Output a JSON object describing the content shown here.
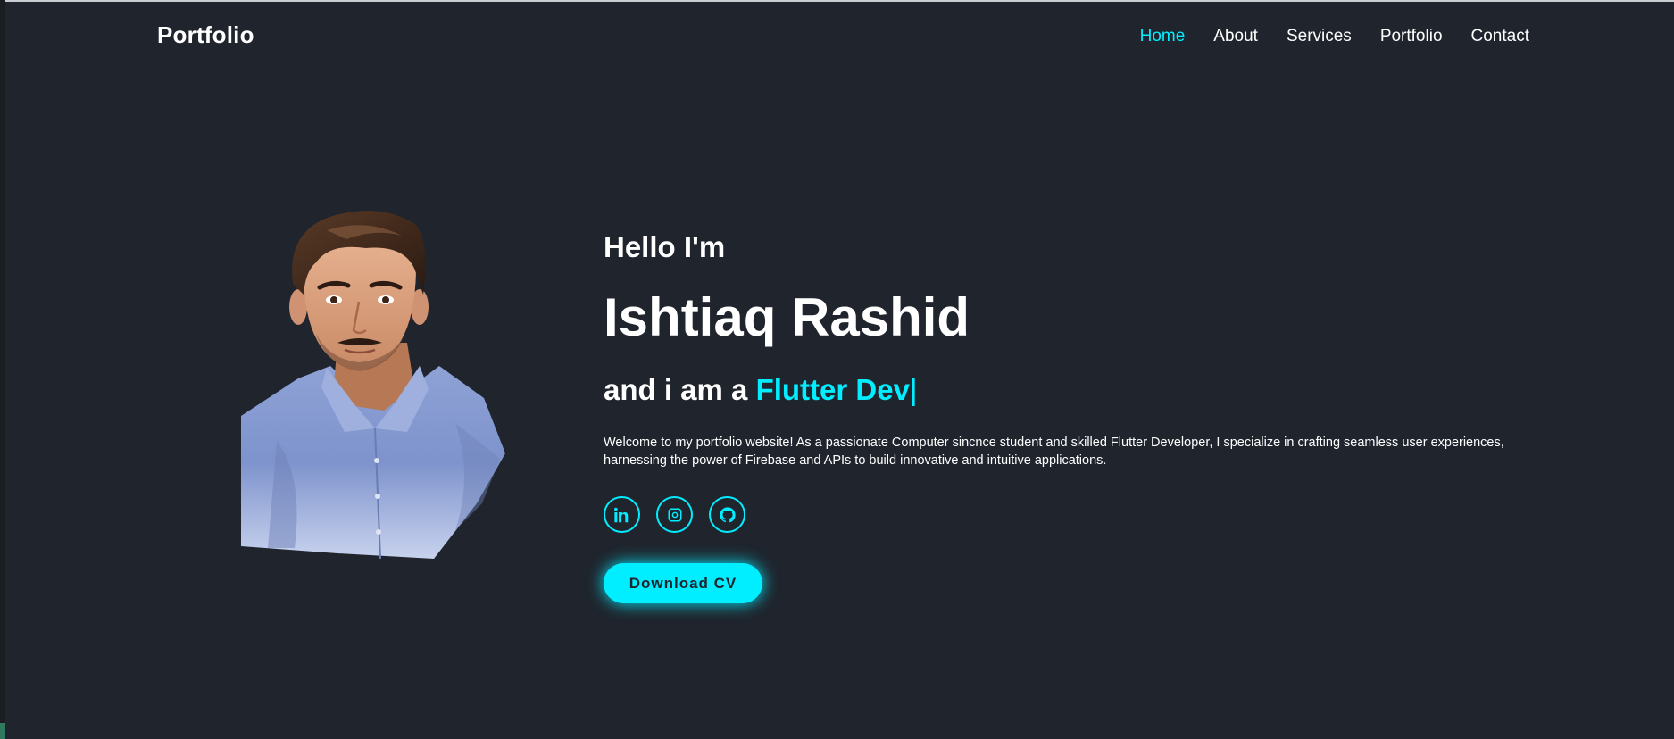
{
  "header": {
    "logo": "Portfolio",
    "nav": [
      {
        "label": "Home",
        "active": true
      },
      {
        "label": "About",
        "active": false
      },
      {
        "label": "Services",
        "active": false
      },
      {
        "label": "Portfolio",
        "active": false
      },
      {
        "label": "Contact",
        "active": false
      }
    ]
  },
  "hero": {
    "greeting": "Hello I'm",
    "name": "Ishtiaq Rashid",
    "role_prefix": "and i am a ",
    "role_highlight": "Flutter Dev",
    "role_cursor": "|",
    "intro": "Welcome to my portfolio website! As a passionate Computer sincnce student and skilled Flutter Developer, I specialize in crafting seamless user experiences, harnessing the power of Firebase and APIs to build innovative and intuitive applications.",
    "socials": [
      {
        "icon": "linkedin-icon"
      },
      {
        "icon": "instagram-icon"
      },
      {
        "icon": "github-icon"
      }
    ],
    "cta_label": "Download CV"
  },
  "colors": {
    "background": "#1f242d",
    "accent": "#00eeff",
    "text": "#ffffff"
  }
}
